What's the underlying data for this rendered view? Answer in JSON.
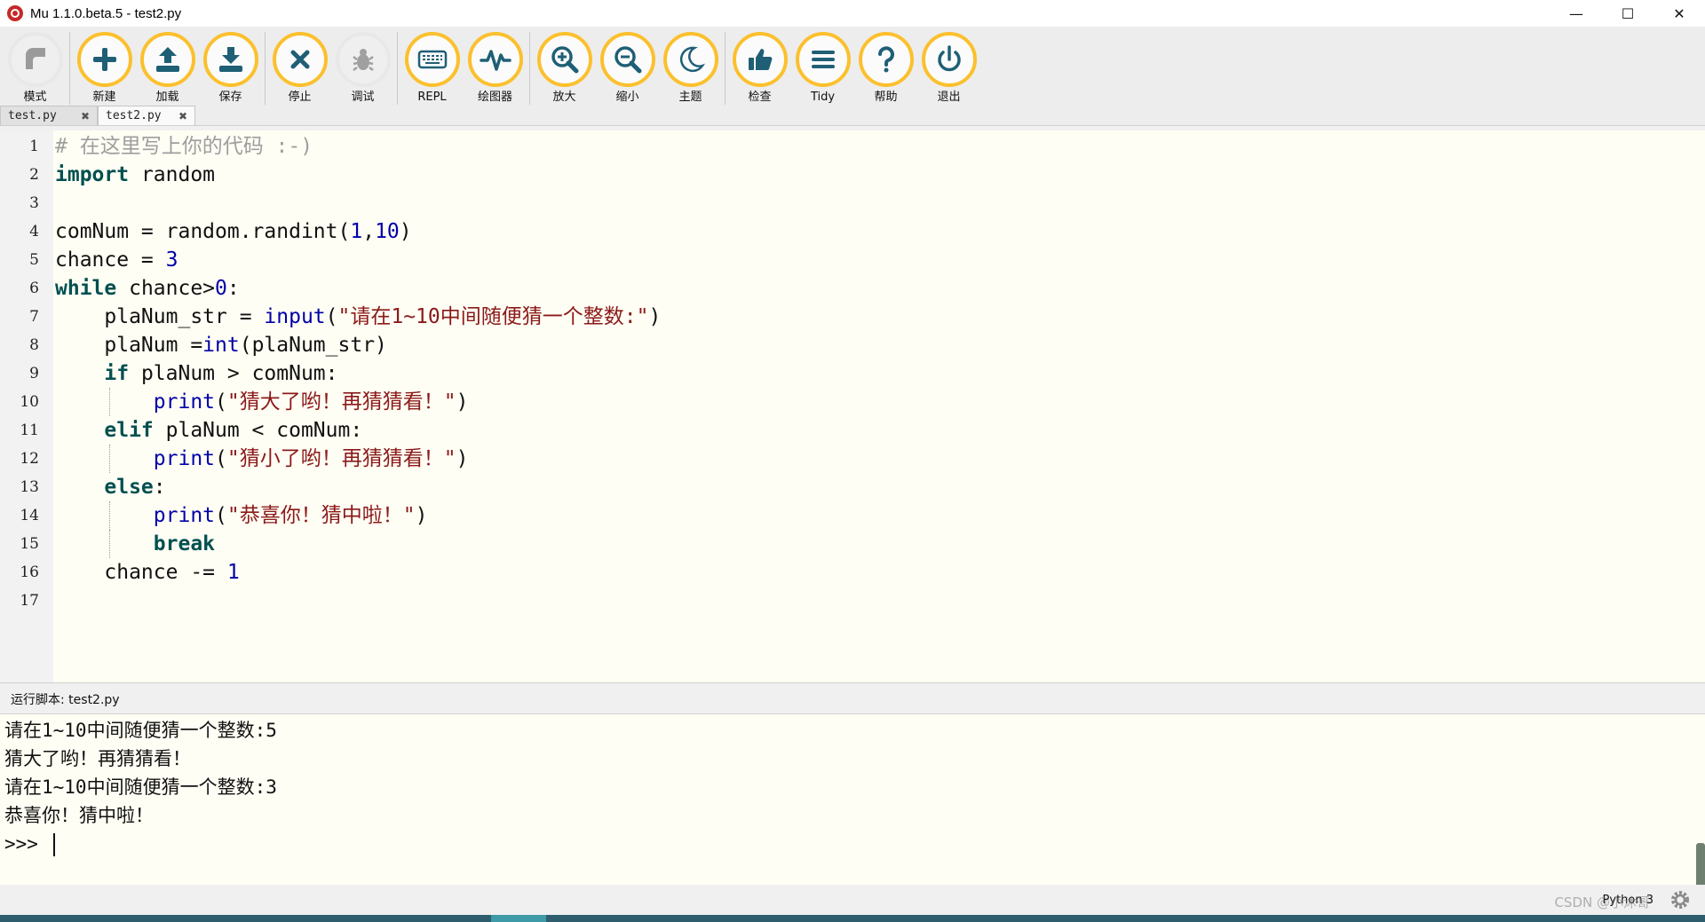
{
  "window": {
    "title": "Mu 1.1.0.beta.5 - test2.py",
    "controls": {
      "minimize": "—",
      "maximize": "☐",
      "close": "✕"
    }
  },
  "toolbar": {
    "buttons": [
      {
        "label": "模式",
        "icon": "mode-icon",
        "enabled": false
      },
      {
        "label": "新建",
        "icon": "plus-icon",
        "enabled": true
      },
      {
        "label": "加载",
        "icon": "upload-icon",
        "enabled": true
      },
      {
        "label": "保存",
        "icon": "download-icon",
        "enabled": true
      },
      {
        "label": "停止",
        "icon": "stop-x-icon",
        "enabled": true
      },
      {
        "label": "调试",
        "icon": "bug-icon",
        "enabled": false
      },
      {
        "label": "REPL",
        "icon": "keyboard-icon",
        "enabled": true
      },
      {
        "label": "绘图器",
        "icon": "pulse-icon",
        "enabled": true
      },
      {
        "label": "放大",
        "icon": "zoom-in-icon",
        "enabled": true
      },
      {
        "label": "缩小",
        "icon": "zoom-out-icon",
        "enabled": true
      },
      {
        "label": "主题",
        "icon": "moon-icon",
        "enabled": true
      },
      {
        "label": "检查",
        "icon": "thumbs-up-icon",
        "enabled": true
      },
      {
        "label": "Tidy",
        "icon": "lines-icon",
        "enabled": true
      },
      {
        "label": "帮助",
        "icon": "question-icon",
        "enabled": true
      },
      {
        "label": "退出",
        "icon": "power-icon",
        "enabled": true
      }
    ]
  },
  "tabs": [
    {
      "label": "test.py",
      "close": "✖",
      "active": false
    },
    {
      "label": "test2.py",
      "close": "✖",
      "active": true
    }
  ],
  "editor": {
    "line_numbers": [
      "1",
      "2",
      "3",
      "4",
      "5",
      "6",
      "7",
      "8",
      "9",
      "10",
      "11",
      "12",
      "13",
      "14",
      "15",
      "16",
      "17"
    ],
    "code": {
      "l1_comment": "# 在这里写上你的代码 :-)",
      "l2_kw": "import",
      "l2_rest": " random",
      "l4_a": "comNum = random.randint(",
      "l4_n1": "1",
      "l4_comma": ",",
      "l4_n2": "10",
      "l4_close": ")",
      "l5_a": "chance = ",
      "l5_n": "3",
      "l6_kw": "while",
      "l6_a": " chance>",
      "l6_n": "0",
      "l6_colon": ":",
      "l7_a": "plaNum_str = ",
      "l7_fn": "input",
      "l7_p": "(",
      "l7_str": "\"请在1~10中间随便猜一个整数:\"",
      "l7_close": ")",
      "l8_a": "plaNum =",
      "l8_fn": "int",
      "l8_b": "(plaNum_str)",
      "l9_kw": "if",
      "l9_a": " plaNum > comNum:",
      "l10_fn": "print",
      "l10_p": "(",
      "l10_str": "\"猜大了哟！再猜猜看！\"",
      "l10_close": ")",
      "l11_kw": "elif",
      "l11_a": " plaNum < comNum:",
      "l12_fn": "print",
      "l12_p": "(",
      "l12_str": "\"猜小了哟！再猜猜看！\"",
      "l12_close": ")",
      "l13_kw": "else",
      "l13_colon": ":",
      "l14_fn": "print",
      "l14_p": "(",
      "l14_str": "\"恭喜你！猜中啦！\"",
      "l14_close": ")",
      "l15_kw": "break",
      "l16_a": "chance -= ",
      "l16_n": "1"
    }
  },
  "repl": {
    "header": "运行脚本: test2.py",
    "lines": [
      "请在1~10中间随便猜一个整数:5",
      "猜大了哟！再猜猜看！",
      "请在1~10中间随便猜一个整数:3",
      "恭喜你！猜中啦！"
    ],
    "prompt": ">>> "
  },
  "status": {
    "mode": "Python 3",
    "watermark": "CSDN @小沐哥"
  },
  "colors": {
    "toolbar_ring": "#fbc02d",
    "icon_teal": "#1f5f76",
    "editor_bg": "#fffef4",
    "keyword": "#005050",
    "string": "#8b1a1a"
  }
}
